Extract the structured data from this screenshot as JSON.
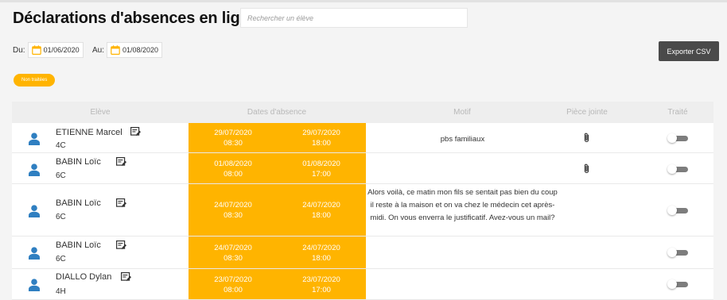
{
  "header": {
    "title": "Déclarations d'absences en ligne",
    "search_placeholder": "Rechercher un élève"
  },
  "filters": {
    "from_label": "Du:",
    "from_value": "01/06/2020",
    "to_label": "Au:",
    "to_value": "01/08/2020",
    "export_label": "Exporter CSV",
    "status_pill": "Non traitées"
  },
  "table": {
    "columns": {
      "eleve": "Elève",
      "dates": "Dates d'absence",
      "motif": "Motif",
      "piece": "Pièce jointe",
      "traite": "Traité"
    },
    "rows": [
      {
        "name": "ETIENNE Marcel",
        "class": "4C",
        "start_date": "29/07/2020",
        "start_time": "08:30",
        "end_date": "29/07/2020",
        "end_time": "18:00",
        "motif": "pbs familiaux",
        "attachment": true,
        "processed": false
      },
      {
        "name": "BABIN Loïc",
        "class": "6C",
        "start_date": "01/08/2020",
        "start_time": "08:00",
        "end_date": "01/08/2020",
        "end_time": "17:00",
        "motif": "",
        "attachment": true,
        "processed": false
      },
      {
        "name": "BABIN Loïc",
        "class": "6C",
        "start_date": "24/07/2020",
        "start_time": "08:30",
        "end_date": "24/07/2020",
        "end_time": "18:00",
        "motif": "Alors voilà, ce matin mon fils se sentait pas bien du coup il reste à la maison et on va chez le médecin cet après-midi. On vous enverra le justificatif. Avez-vous un mail?",
        "attachment": false,
        "processed": false
      },
      {
        "name": "BABIN Loïc",
        "class": "6C",
        "start_date": "24/07/2020",
        "start_time": "08:30",
        "end_date": "24/07/2020",
        "end_time": "18:00",
        "motif": "",
        "attachment": false,
        "processed": false
      },
      {
        "name": "DIALLO Dylan",
        "class": "4H",
        "start_date": "23/07/2020",
        "start_time": "08:00",
        "end_date": "23/07/2020",
        "end_time": "17:00",
        "motif": "",
        "attachment": false,
        "processed": false
      }
    ]
  },
  "colors": {
    "accent": "#ffb400",
    "avatar": "#2f7fc1",
    "export_bg": "#4a4a4a"
  },
  "icons": {
    "date": "calendar-icon",
    "student": "person-icon",
    "edit": "edit-note-icon",
    "attachment": "paperclip-icon"
  }
}
